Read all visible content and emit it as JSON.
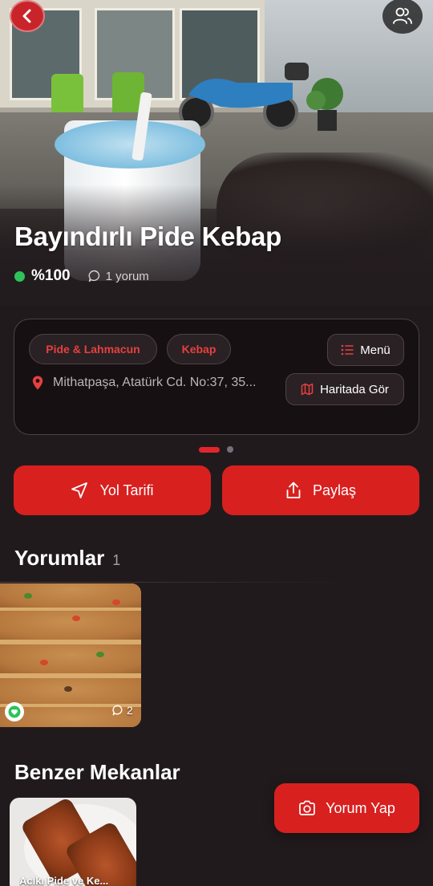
{
  "restaurant": {
    "name": "Bayındırlı Pide Kebap",
    "rating_percent": "%100",
    "comment_count_label": "1 yorum"
  },
  "info": {
    "categories": [
      "Pide & Lahmacun",
      "Kebap"
    ],
    "menu_label": "Menü",
    "address": "Mithatpaşa, Atatürk Cd. No:37, 35...",
    "map_label": "Haritada Gör"
  },
  "pagination": {
    "total": 2,
    "active": 0
  },
  "actions": {
    "directions_label": "Yol Tarifi",
    "share_label": "Paylaş"
  },
  "reviews": {
    "title": "Yorumlar",
    "count": "1",
    "items": [
      {
        "comment_count": "2",
        "liked": true
      }
    ]
  },
  "similar": {
    "title": "Benzer Mekanlar",
    "items": [
      {
        "name": "Acıkı Pide ve Ke..."
      }
    ]
  },
  "fab": {
    "label": "Yorum Yap"
  },
  "colors": {
    "accent": "#d8201f",
    "background": "#211a1d",
    "card": "#161013",
    "chip_text": "#e6403f",
    "rating_dot": "#2ec25a"
  },
  "icons": {
    "back": "chevron-left-icon",
    "users": "users-icon",
    "comment": "comment-bubble-icon",
    "menu": "list-icon",
    "location": "location-pin-icon",
    "map": "map-icon",
    "directions": "navigation-arrow-icon",
    "share": "share-icon",
    "heart": "heart-icon",
    "camera": "camera-icon"
  }
}
